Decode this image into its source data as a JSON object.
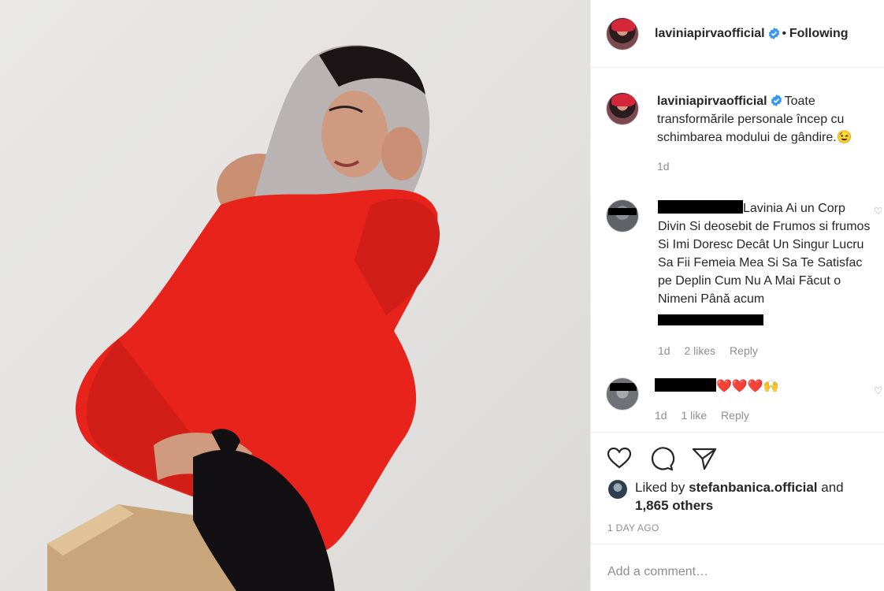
{
  "post": {
    "author": "laviniapirvaofficial",
    "follow_status": "Following",
    "separator": "•",
    "caption": "Toate transformările personale încep cu schimbarea modului de gândire.",
    "caption_emoji": "😉",
    "caption_time": "1d"
  },
  "comments": [
    {
      "text": "Lavinia Ai un Corp Divin Si deosebit de Frumos si frumos Si Imi Doresc Decât Un Singur Lucru Sa Fii Femeia Mea Si Sa Te Satisfac pe Deplin Cum Nu A Mai Făcut o Nimeni Până acum",
      "time": "1d",
      "likes": "2 likes",
      "reply": "Reply"
    },
    {
      "text": "❤️❤️❤️🙌",
      "time": "1d",
      "likes": "1 like",
      "reply": "Reply"
    }
  ],
  "likes": {
    "prefix": "Liked by",
    "user": "stefanbanica.official",
    "and": "and",
    "others": "1,865 others"
  },
  "timestamp": "1 DAY AGO",
  "add_comment": {
    "placeholder": "Add a comment…"
  },
  "colors": {
    "verified": "#3897f0",
    "text": "#262626",
    "muted": "#8e8e8e",
    "sweater": "#e8231c"
  },
  "icons": [
    "heart-icon",
    "comment-icon",
    "share-icon",
    "verified-icon",
    "like-comment-icon"
  ]
}
